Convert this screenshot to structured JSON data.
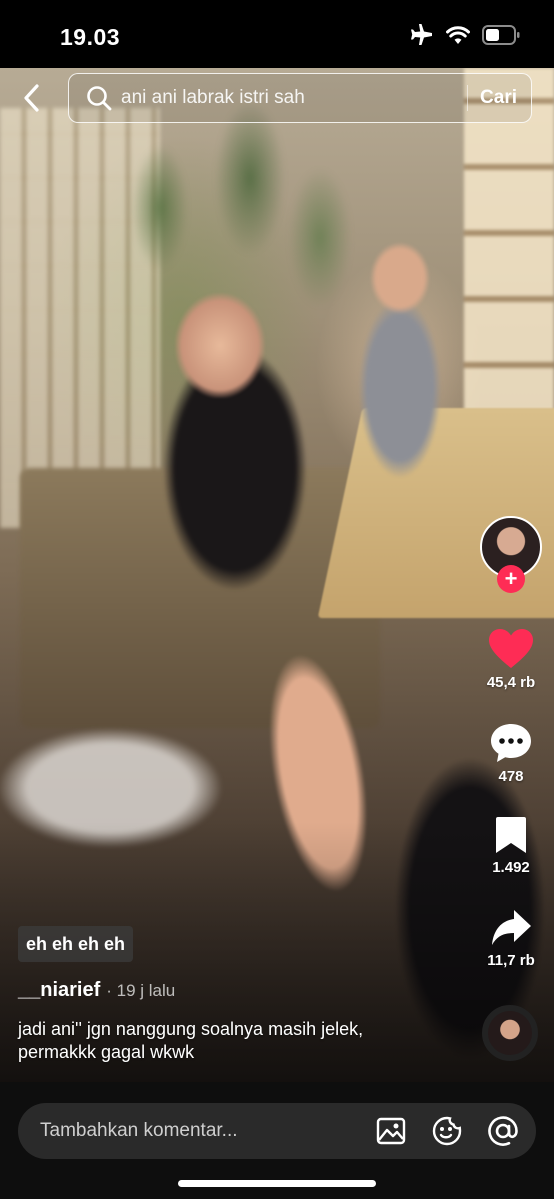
{
  "status_bar": {
    "time": "19.03",
    "icons": [
      "airplane-icon",
      "wifi-icon",
      "battery-icon"
    ]
  },
  "search": {
    "query": "ani ani labrak istri sah",
    "submit_label": "Cari",
    "icon": "search-icon"
  },
  "actions": {
    "likes": "45,4 rb",
    "comments": "478",
    "saves": "1.492",
    "shares": "11,7 rb",
    "like_color": "#fe2c55"
  },
  "follow_label": "+",
  "post": {
    "overlay_text": "eh eh eh eh",
    "username": "__niarief",
    "time_ago": "· 19 j lalu",
    "caption": "jadi ani'' jgn nanggung soalnya masih jelek, permakkk gagal wkwk"
  },
  "comment_bar": {
    "placeholder": "Tambahkan komentar...",
    "icons": [
      "image-icon",
      "emoji-icon",
      "mention-icon"
    ]
  },
  "colors": {
    "accent": "#fe2c55",
    "background": "#000000",
    "comment_field": "#2a2a2a"
  }
}
